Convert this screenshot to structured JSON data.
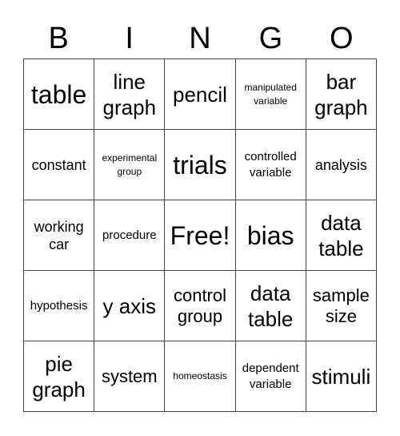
{
  "header": [
    "B",
    "I",
    "N",
    "G",
    "O"
  ],
  "cells": [
    {
      "text": "table",
      "size": "s-xl"
    },
    {
      "text": "line graph",
      "size": "s-l"
    },
    {
      "text": "pencil",
      "size": "s-l"
    },
    {
      "text": "manipulated variable",
      "size": "s-xxs"
    },
    {
      "text": "bar graph",
      "size": "s-l"
    },
    {
      "text": "constant",
      "size": "s-s"
    },
    {
      "text": "experimental group",
      "size": "s-xxs"
    },
    {
      "text": "trials",
      "size": "s-xl"
    },
    {
      "text": "controlled variable",
      "size": "s-xs"
    },
    {
      "text": "analysis",
      "size": "s-s"
    },
    {
      "text": "working car",
      "size": "s-s"
    },
    {
      "text": "procedure",
      "size": "s-xs"
    },
    {
      "text": "Free!",
      "size": "s-xl"
    },
    {
      "text": "bias",
      "size": "s-xl"
    },
    {
      "text": "data table",
      "size": "s-l"
    },
    {
      "text": "hypothesis",
      "size": "s-xs"
    },
    {
      "text": "y axis",
      "size": "s-l"
    },
    {
      "text": "control group",
      "size": "s-m"
    },
    {
      "text": "data table",
      "size": "s-l"
    },
    {
      "text": "sample size",
      "size": "s-m"
    },
    {
      "text": "pie graph",
      "size": "s-l"
    },
    {
      "text": "system",
      "size": "s-m"
    },
    {
      "text": "homeostasis",
      "size": "s-xxs"
    },
    {
      "text": "dependent variable",
      "size": "s-xs"
    },
    {
      "text": "stimuli",
      "size": "s-l"
    }
  ]
}
